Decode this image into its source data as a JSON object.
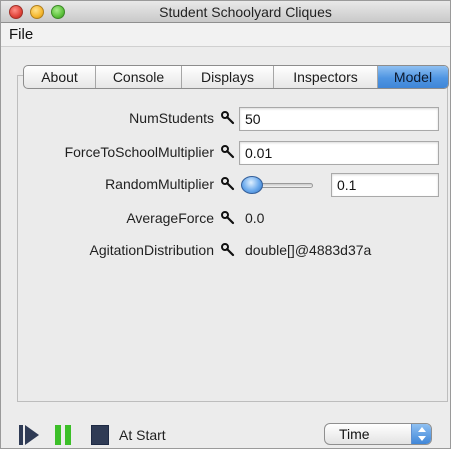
{
  "window": {
    "title": "Student Schoolyard Cliques"
  },
  "menubar": {
    "file": "File"
  },
  "tabs": [
    {
      "label": "About",
      "active": false
    },
    {
      "label": "Console",
      "active": false
    },
    {
      "label": "Displays",
      "active": false
    },
    {
      "label": "Inspectors",
      "active": false
    },
    {
      "label": "Model",
      "active": true
    }
  ],
  "model": {
    "num_students": {
      "label": "NumStudents",
      "value": "50"
    },
    "force_to_school": {
      "label": "ForceToSchoolMultiplier",
      "value": "0.01"
    },
    "random_multiplier": {
      "label": "RandomMultiplier",
      "value": "0.1",
      "slider_fraction": 0.0
    },
    "average_force": {
      "label": "AverageForce",
      "value": "0.0"
    },
    "agitation_distribution": {
      "label": "AgitationDistribution",
      "value": "double[]@4883d37a"
    }
  },
  "controls": {
    "status": "At Start",
    "time_select": "Time",
    "icons": [
      "play-icon",
      "pause-icon",
      "stop-icon"
    ]
  },
  "colors": {
    "accent": "#4f95e2",
    "play": "#2f3b55",
    "pause": "#3cbf28"
  }
}
